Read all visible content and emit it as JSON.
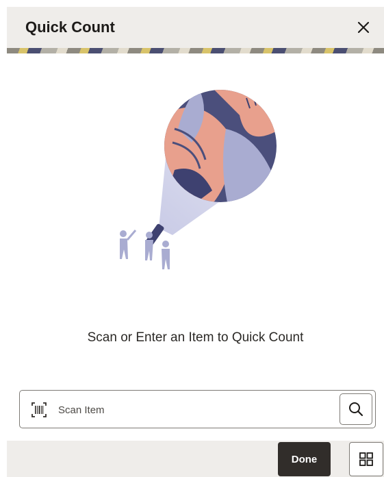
{
  "header": {
    "title": "Quick Count",
    "close_icon": "close-icon"
  },
  "main": {
    "illustration": "spotlight-people-illustration",
    "prompt": "Scan or Enter an Item to Quick Count"
  },
  "scan": {
    "placeholder": "Scan Item",
    "value": "",
    "barcode_icon": "barcode-scan-icon",
    "search_icon": "search-icon"
  },
  "footer": {
    "done_label": "Done",
    "grid_icon": "grid-icon"
  },
  "colors": {
    "header_bg": "#efedea",
    "primary_button": "#312d2a",
    "text": "#1d1b19",
    "illustration_navy": "#4b4f7c",
    "illustration_coral": "#e8a08d",
    "illustration_lavender": "#a9acd1"
  }
}
